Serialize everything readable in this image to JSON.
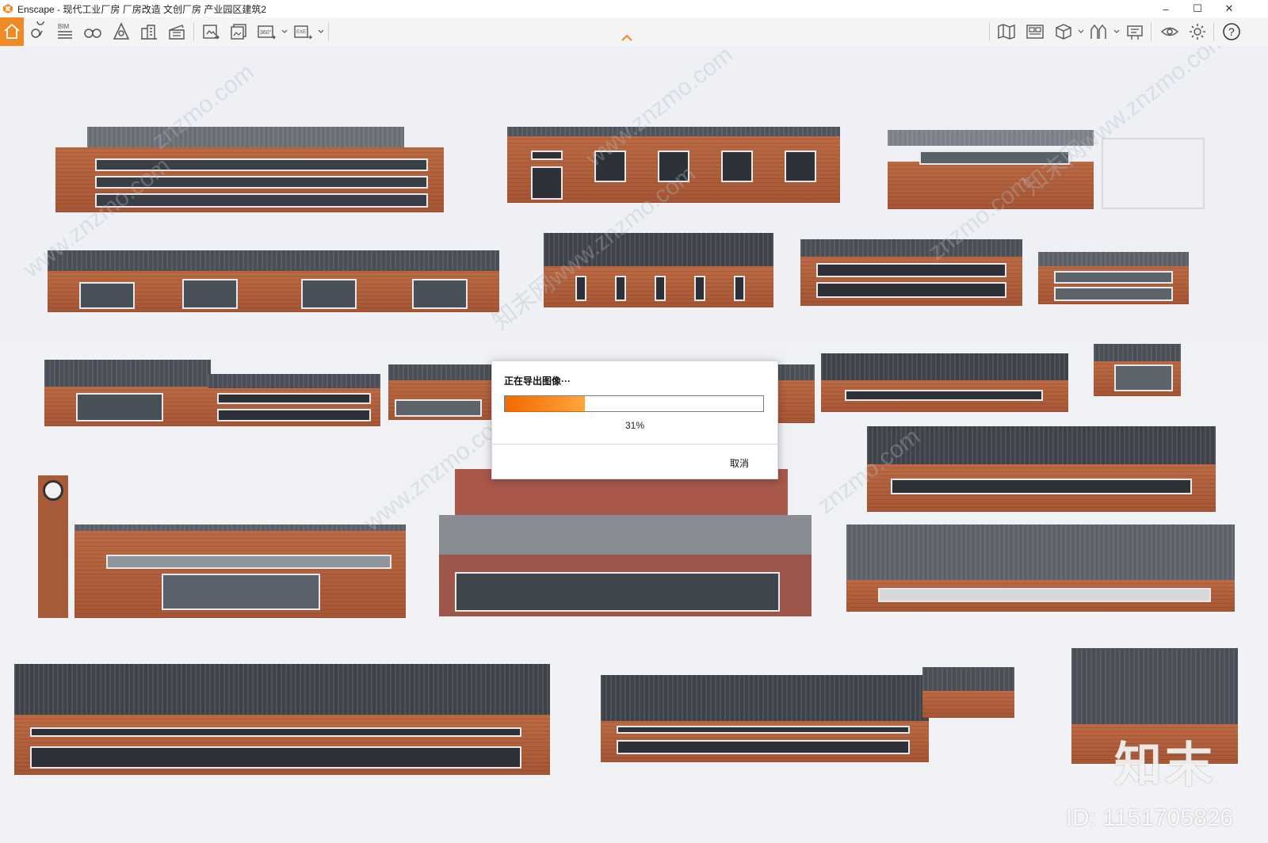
{
  "window": {
    "title": "Enscape - 现代工业厂房 厂房改造 文创厂房 产业园区建筑2",
    "controls": {
      "minimize": "–",
      "maximize": "☐",
      "close": "✕"
    }
  },
  "toolbar": {
    "bim_label": "BIM",
    "pano_label": "360°",
    "exe_label": "EXE",
    "help_label": "?",
    "accent_color": "#f08a24"
  },
  "export_dialog": {
    "title": "正在导出图像···",
    "progress_percent": 31,
    "progress_text": "31%",
    "cancel_label": "取消"
  },
  "watermark": {
    "brand": "知末",
    "id_text": "ID: 1151705826",
    "tiles": [
      "www.znzmo.com",
      "znzmo.com",
      "知末网www.znzmo.com",
      "www.znzmo.com",
      "znzmo.com",
      "知末网www.znzmo.com",
      "www.znzmo.com",
      "znzmo.com"
    ]
  }
}
